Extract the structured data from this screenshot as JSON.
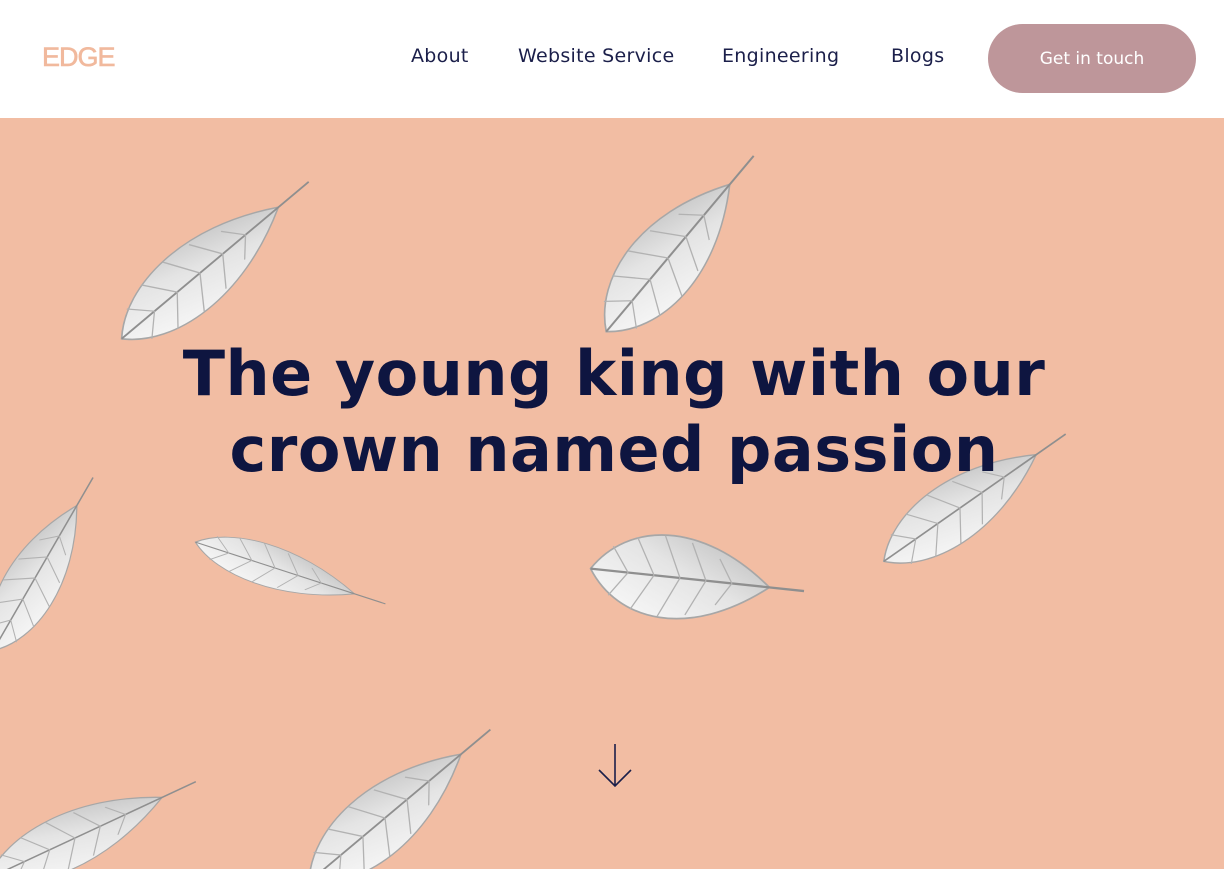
{
  "brand": {
    "name": "EDGE"
  },
  "nav": {
    "items": [
      {
        "label": "About"
      },
      {
        "label": "Website Service"
      },
      {
        "label": "Engineering"
      },
      {
        "label": "Blogs"
      }
    ],
    "cta_label": "Get in touch"
  },
  "hero": {
    "headline_line1": "The young king with our",
    "headline_line2": "crown named passion",
    "scroll_icon": "arrow-down-icon"
  },
  "colors": {
    "brand": "#f1b99d",
    "hero_background": "#f2bda3",
    "headline": "#0e1540",
    "nav_text": "#1b1f4a",
    "cta_background": "#be969a",
    "cta_text": "#ffffff"
  }
}
